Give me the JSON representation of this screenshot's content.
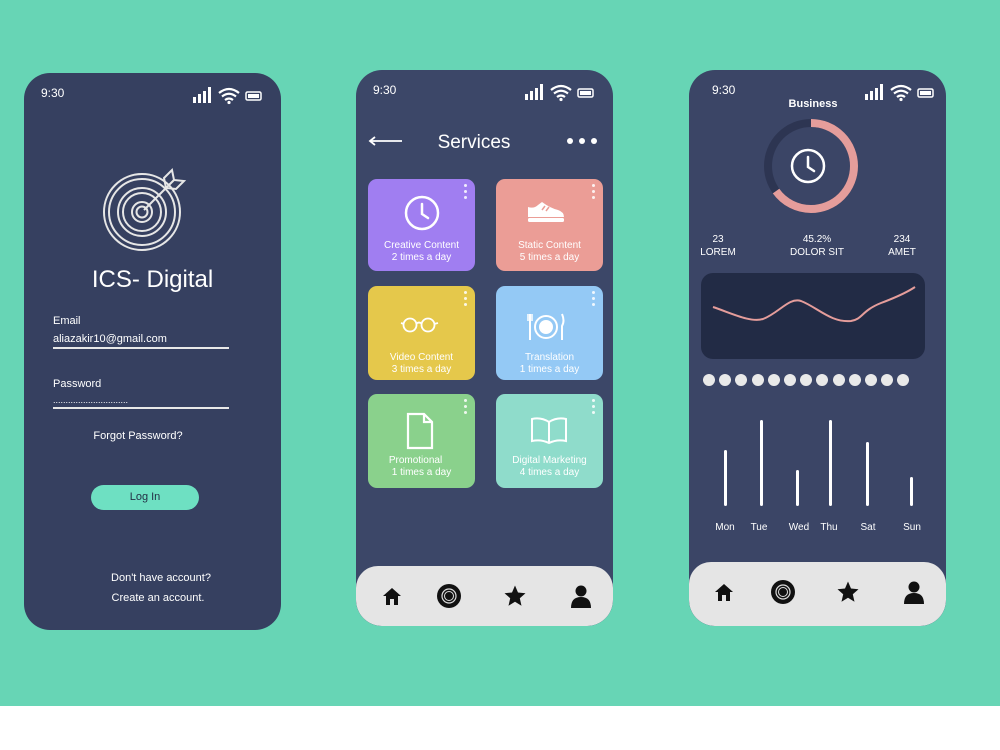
{
  "colors": {
    "background": "#67d5b5",
    "phone": "#3a4566",
    "accent_mint": "#6ee0c2",
    "tabbar": "#e5e5e5",
    "ring_progress": "#e59d9b"
  },
  "status_bar": {
    "time": "9:30"
  },
  "login": {
    "app_title": "ICS- Digital",
    "email_label": "Email",
    "email_value": "aliazakir10@gmail.com",
    "password_label": "Password",
    "password_value": "..............................",
    "forgot_password": "Forgot Password?",
    "login_button": "Log In",
    "no_account": "Don't have account?",
    "create_account": "Create an account."
  },
  "services": {
    "title": "Services",
    "tiles": [
      {
        "name": "Creative Content",
        "frequency": "2 times a day",
        "color": "#a07ef1",
        "icon": "clock-icon"
      },
      {
        "name": "Static Content",
        "frequency": "5 times a day",
        "color": "#eb9d96",
        "icon": "shoe-icon"
      },
      {
        "name": "Video Content",
        "frequency": "3 times a day",
        "color": "#e5c84b",
        "icon": "glasses-icon"
      },
      {
        "name": "Translation",
        "frequency": "1 times a day",
        "color": "#94c9f5",
        "icon": "plate-cutlery-icon"
      },
      {
        "name": "Promotional",
        "frequency": "1 times a day",
        "color": "#8ad18c",
        "icon": "document-icon"
      },
      {
        "name": "Digital Marketing",
        "frequency": "4 times a day",
        "color": "#8fdccb",
        "icon": "book-icon"
      }
    ]
  },
  "business": {
    "title": "Business",
    "ring_progress": 0.65,
    "stats": [
      {
        "value": "23",
        "label": "LOREM"
      },
      {
        "value": "45.2%",
        "label": "DOLOR SIT"
      },
      {
        "value": "234",
        "label": "AMET"
      }
    ],
    "days": [
      "Mon",
      "Tue",
      "Wed",
      "Thu",
      "Sat",
      "Sun"
    ]
  },
  "tabbar": {
    "icons": [
      "home-icon",
      "target-icon",
      "star-icon",
      "user-icon"
    ]
  }
}
